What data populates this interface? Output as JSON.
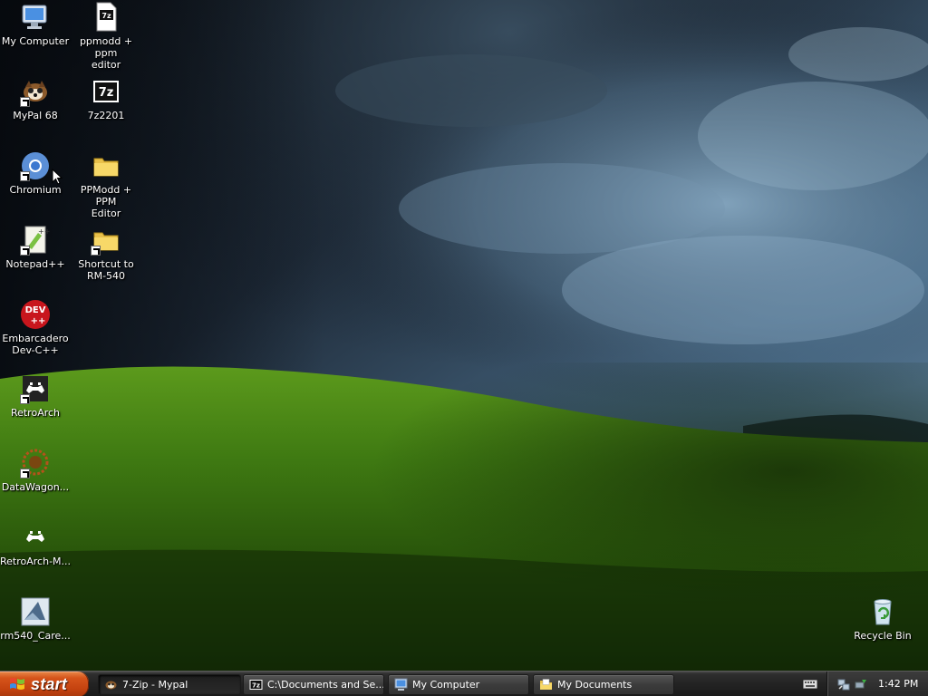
{
  "desktop": {
    "icons": [
      {
        "label": "My Computer",
        "icon": "computer-icon"
      },
      {
        "label": "ppmodd + ppm\neditor",
        "icon": "7zip-archive-icon"
      },
      {
        "label": "MyPal 68",
        "icon": "mypal-icon"
      },
      {
        "label": "7z2201",
        "icon": "7zip-icon"
      },
      {
        "label": "Chromium",
        "icon": "chromium-icon"
      },
      {
        "label": "PPModd + PPM\nEditor",
        "icon": "folder-icon"
      },
      {
        "label": "Notepad++",
        "icon": "notepad-plus-plus-icon"
      },
      {
        "label": "Shortcut to\nRM-540",
        "icon": "folder-icon"
      },
      {
        "label": "Embarcadero\nDev-C++",
        "icon": "dev-cpp-icon"
      },
      {
        "label": "RetroArch",
        "icon": "retroarch-icon"
      },
      {
        "label": "DataWagon...",
        "icon": "datawagon-icon"
      },
      {
        "label": "RetroArch-M...",
        "icon": "retroarch-icon"
      },
      {
        "label": "rm540_Care...",
        "icon": "rm540-icon"
      },
      {
        "label": "Recycle Bin",
        "icon": "recycle-bin-icon"
      }
    ]
  },
  "taskbar": {
    "start_label": "start",
    "tasks": [
      {
        "label": "7-Zip - Mypal",
        "icon": "mypal-icon",
        "active": true
      },
      {
        "label": "C:\\Documents and Se...",
        "icon": "7zip-icon",
        "active": false
      },
      {
        "label": "My Computer",
        "icon": "computer-icon",
        "active": false
      },
      {
        "label": "My Documents",
        "icon": "folder-icon",
        "active": false
      }
    ],
    "tray": {
      "icons": [
        "keyboard-icon",
        "network-icon",
        "safely-remove-icon"
      ],
      "clock": "1:42 PM"
    }
  },
  "colors": {
    "start_button": "#d6541b",
    "taskbar": "#232323",
    "sky": "#2b3f55",
    "hill": "#3f7a12"
  }
}
